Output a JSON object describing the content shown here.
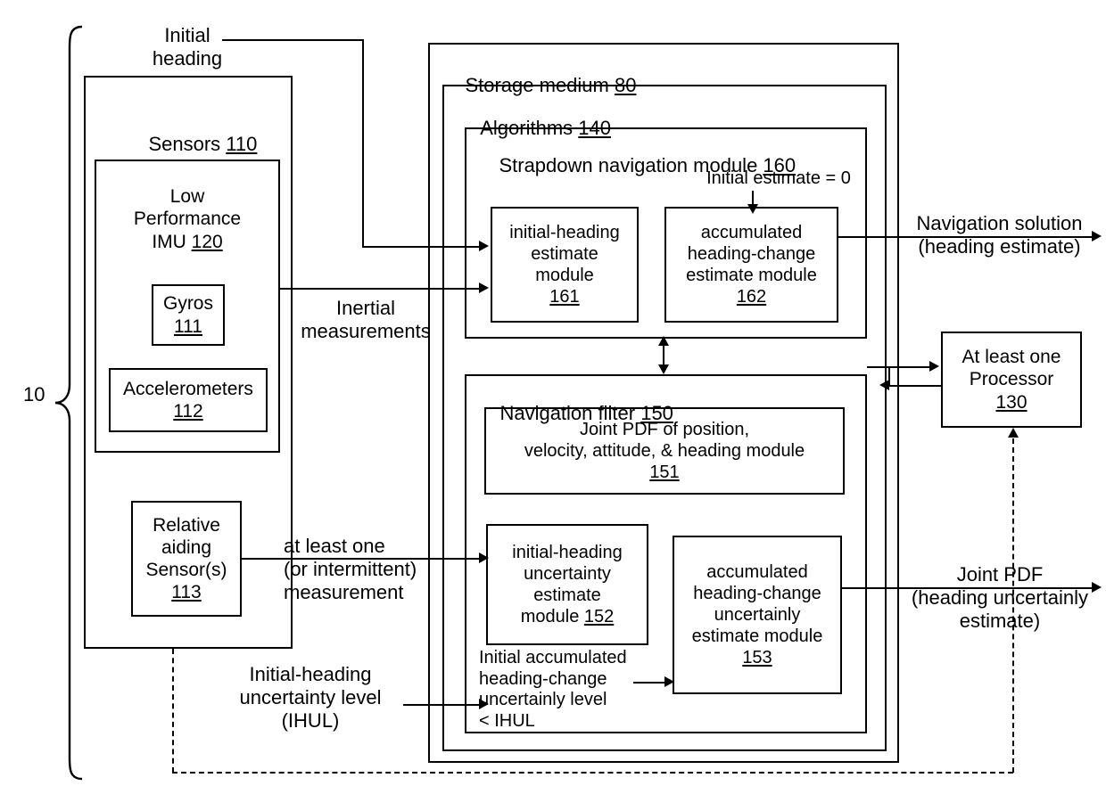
{
  "figure": {
    "system_ref": "10"
  },
  "sensors": {
    "title_text": "Sensors ",
    "title_ref": "110",
    "imu": {
      "label": "Low\nPerformance\nIMU ",
      "ref": "120"
    },
    "gyros": {
      "label": "Gyros\n",
      "ref": "111"
    },
    "accelerometers": {
      "label": "Accelerometers\n",
      "ref": "112"
    },
    "relative_aiding": {
      "label": "Relative\naiding\nSensor(s)\n",
      "ref": "113"
    }
  },
  "storage": {
    "title_text": "Storage medium ",
    "title_ref": "80",
    "algorithms": {
      "title_text": "Algorithms ",
      "title_ref": "140"
    },
    "strapdown": {
      "title_text": "Strapdown navigation module ",
      "title_ref": "160",
      "initial_estimate_note": "Initial estimate = 0",
      "module_161": {
        "label": "initial-heading\nestimate\nmodule\n",
        "ref": "161"
      },
      "module_162": {
        "label": "accumulated\nheading-change\nestimate module\n",
        "ref": "162"
      }
    },
    "nav_filter": {
      "title_text": "Navigation filter ",
      "title_ref": "150",
      "module_151": {
        "label": "Joint PDF of position,\nvelocity, attitude, & heading module\n",
        "ref": "151"
      },
      "module_152": {
        "label": "initial-heading\nuncertainty\nestimate\nmodule ",
        "ref": "152"
      },
      "module_153": {
        "label": "accumulated\nheading-change\nuncertainly\nestimate module\n",
        "ref": "153"
      },
      "internal_note": "Initial accumulated\nheading-change\nuncertainly level\n< IHUL"
    }
  },
  "processor": {
    "label": "At least one\nProcessor\n",
    "ref": "130"
  },
  "connectors": {
    "initial_heading": "Initial\nheading",
    "inertial_measurements": "Inertial\nmeasurements",
    "at_least_one_measurement": "at least one\n(or intermittent)\nmeasurement",
    "ihul": "Initial-heading\nuncertainty level\n(IHUL)",
    "navigation_solution": "Navigation solution\n(heading estimate)",
    "joint_pdf_out": "Joint PDF\n(heading uncertainly\nestimate)"
  }
}
